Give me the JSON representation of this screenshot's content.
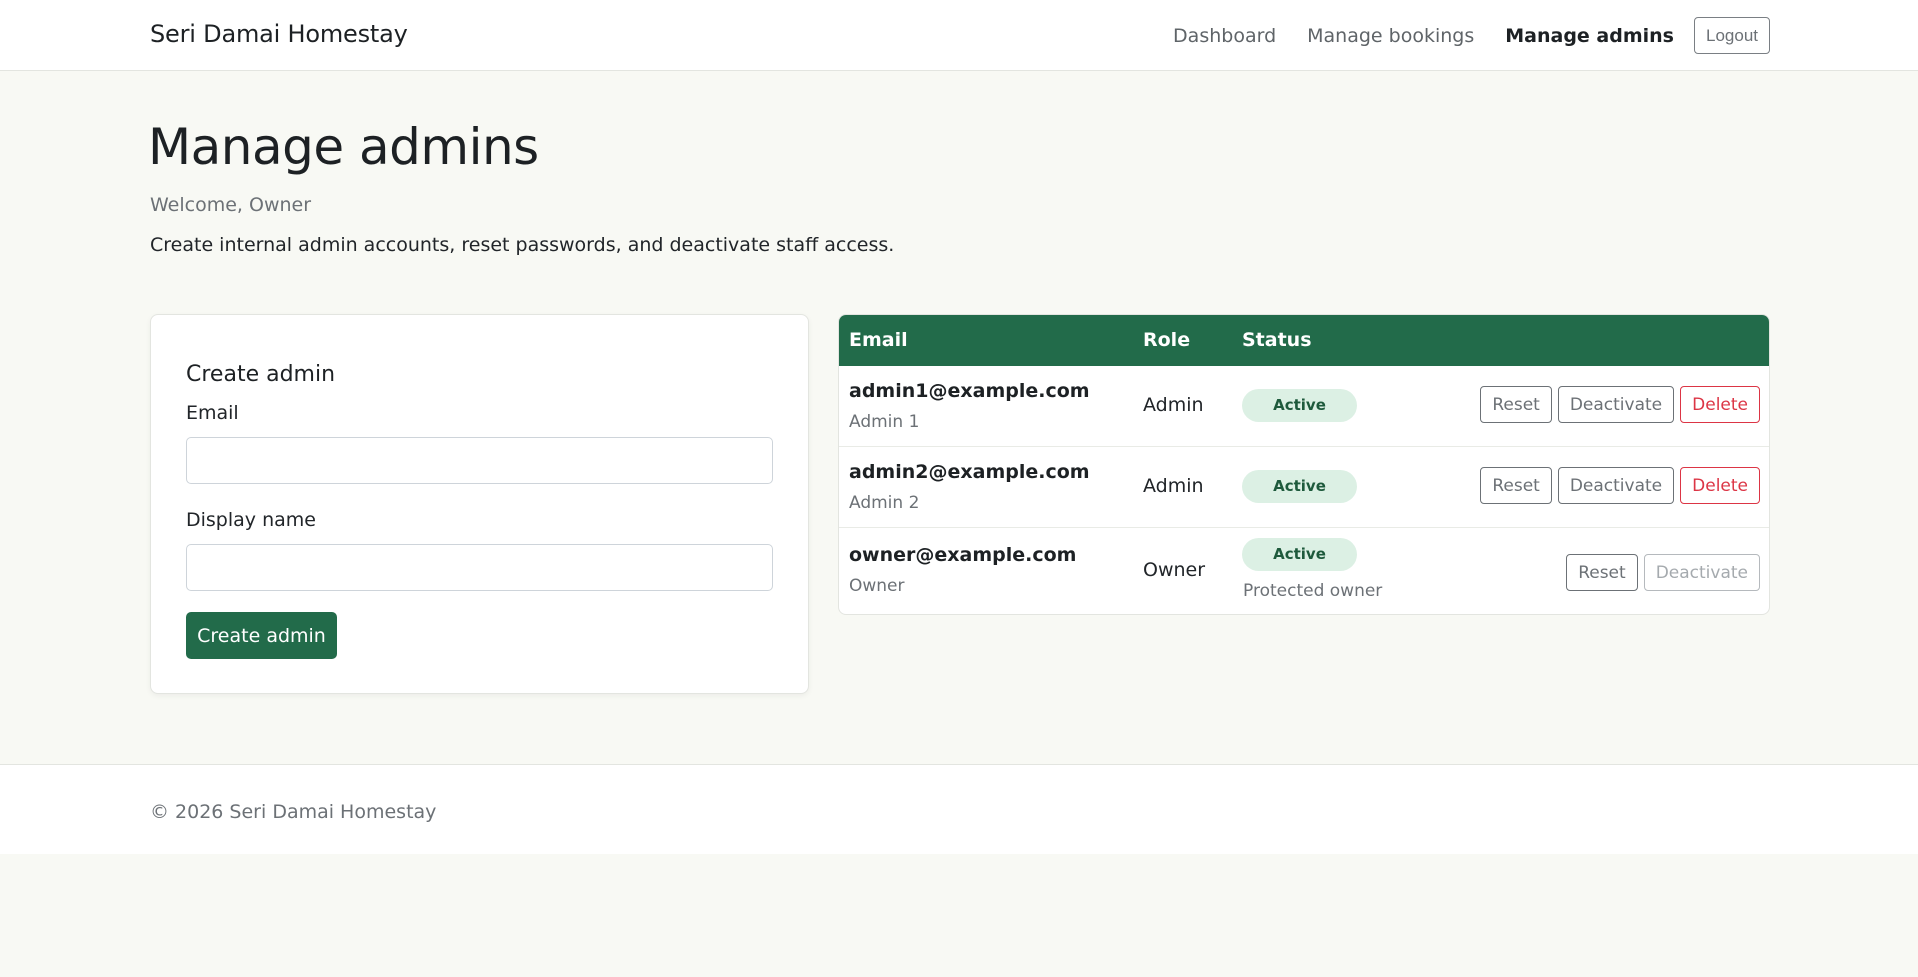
{
  "navbar": {
    "brand": "Seri Damai Homestay",
    "links": [
      {
        "label": "Dashboard",
        "active": false
      },
      {
        "label": "Manage bookings",
        "active": false
      },
      {
        "label": "Manage admins",
        "active": true
      }
    ],
    "logout_label": "Logout"
  },
  "header": {
    "title": "Manage admins",
    "welcome": "Welcome, Owner",
    "intro": "Create internal admin accounts, reset passwords, and deactivate staff access."
  },
  "create_form": {
    "title": "Create admin",
    "email_label": "Email",
    "email_value": "",
    "display_name_label": "Display name",
    "display_name_value": "",
    "submit_label": "Create admin"
  },
  "admins_table": {
    "columns": [
      "Email",
      "Role",
      "Status"
    ],
    "rows": [
      {
        "email": "admin1@example.com",
        "name": "Admin 1",
        "role": "Admin",
        "status": "Active",
        "note": "",
        "actions": [
          "Reset",
          "Deactivate",
          "Delete"
        ]
      },
      {
        "email": "admin2@example.com",
        "name": "Admin 2",
        "role": "Admin",
        "status": "Active",
        "note": "",
        "actions": [
          "Reset",
          "Deactivate",
          "Delete"
        ]
      },
      {
        "email": "owner@example.com",
        "name": "Owner",
        "role": "Owner",
        "status": "Active",
        "note": "Protected owner",
        "actions": [
          "Reset",
          "Deactivate"
        ]
      }
    ]
  },
  "footer": {
    "text": "© 2026 Seri Damai Homestay"
  },
  "colors": {
    "brand_green": "#226b4a",
    "badge_bg": "#dcf0e4",
    "danger": "#dc3545",
    "page_bg": "#f8f9f4"
  }
}
